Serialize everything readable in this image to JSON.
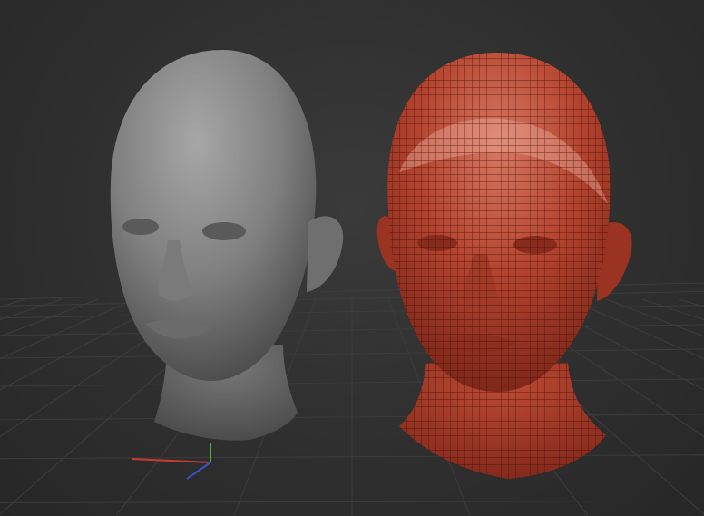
{
  "viewport": {
    "background": "#2d2d2d",
    "grid_color": "#3c3c3c"
  },
  "models": [
    {
      "name": "sculpt-head-gray",
      "material": "gray-clay",
      "color": "#8a8a8a"
    },
    {
      "name": "sculpt-head-red-wireframe",
      "material": "red-wax-polyframe",
      "color": "#b2412c"
    }
  ],
  "gizmo": {
    "x_color": "#c83c32",
    "y_color": "#3fbf3f",
    "z_color": "#3c4fc8"
  }
}
